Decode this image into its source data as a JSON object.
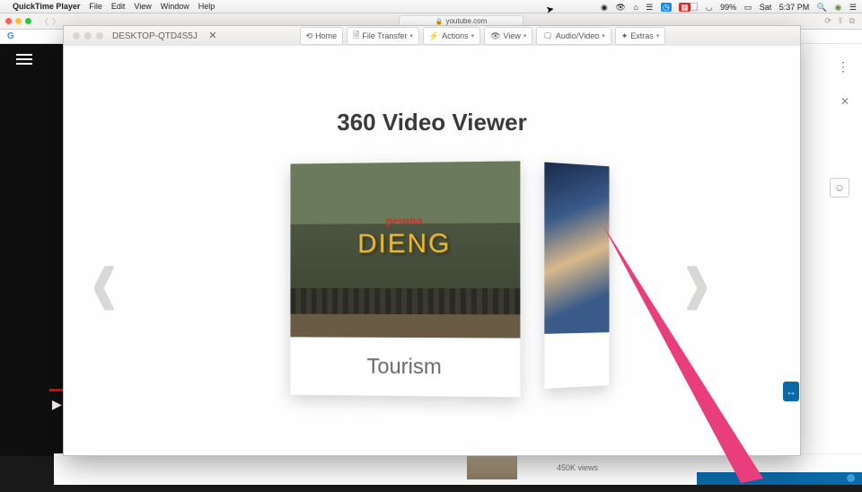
{
  "menubar": {
    "app": "QuickTime Player",
    "items": [
      "File",
      "Edit",
      "View",
      "Window",
      "Help"
    ],
    "right": {
      "battery_pct": "99%",
      "battery_icon": "⚡",
      "day": "Sat",
      "time": "5:37 PM"
    }
  },
  "safari": {
    "url": "youtube.com"
  },
  "remote_window": {
    "title": "DESKTOP-QTD4S5J",
    "toolbar": {
      "home": "Home",
      "file_transfer": "File Transfer",
      "actions": "Actions",
      "view": "View",
      "audio_video": "Audio/Video",
      "extras": "Extras"
    },
    "app": {
      "heading": "360 Video Viewer",
      "cards": [
        {
          "sign_top": "pesona",
          "sign_main": "DIENG",
          "label": "Tourism"
        },
        {
          "label": ""
        }
      ]
    }
  },
  "youtube_strip": {
    "views": "450K views"
  }
}
